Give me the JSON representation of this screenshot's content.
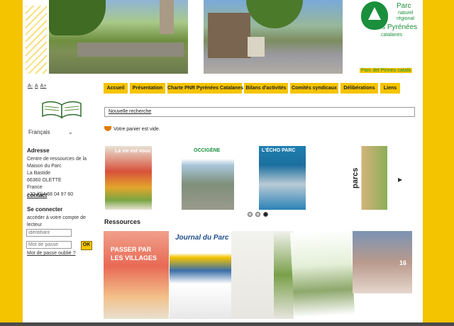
{
  "logo": {
    "line1": "Parc",
    "line2": "naturel",
    "line3": "régional",
    "line4": "des Pyrénées",
    "line5": "catalanes",
    "sub": "Parc del Pirineu català"
  },
  "font_size": {
    "small": "A-",
    "normal": "A",
    "large": "A+"
  },
  "language": {
    "selected": "Français"
  },
  "address": {
    "heading": "Adresse",
    "lines": [
      "Centre de ressources de la",
      "Maison du Parc",
      "La Bastide",
      "66360 OLETTE",
      "France",
      "+33 (0)4 68 04 97 60"
    ],
    "contact_link": "contact"
  },
  "login": {
    "heading": "Se connecter",
    "text": "accéder à votre compte de lecteur",
    "username_placeholder": "identifiant",
    "password_placeholder": "Mot de passe",
    "ok_label": "OK",
    "forgot_link": "Mot de passe oublié ?"
  },
  "nav": [
    "Accueil",
    "Présentation",
    "Charte PNR Pyrénées Catalanes",
    "Bilans d'activités",
    "Comités syndicaux",
    "Délibérations",
    "Liens"
  ],
  "search": {
    "link": "Nouvelle recherche"
  },
  "cart": {
    "text": "Votre panier est vide."
  },
  "carousel": {
    "covers": [
      {
        "label": "La vie est vous"
      },
      {
        "label": "OCCIGÈNE"
      },
      {
        "label": "L'ÉCHO PARC"
      },
      {
        "label": "parcs"
      }
    ],
    "next_arrow": "▶",
    "active_dot": 2
  },
  "resources": {
    "title": "Ressources",
    "items": [
      {
        "label": "PASSER PAR LES VILLAGES"
      },
      {
        "label": "Journal du Parc"
      },
      {
        "label": ""
      },
      {
        "label": ""
      },
      {
        "label": ""
      },
      {
        "label": "16"
      }
    ]
  },
  "colors": {
    "accent": "#f5c400",
    "brand_green": "#1a8f3c",
    "cart_icon": "#e07a10"
  }
}
